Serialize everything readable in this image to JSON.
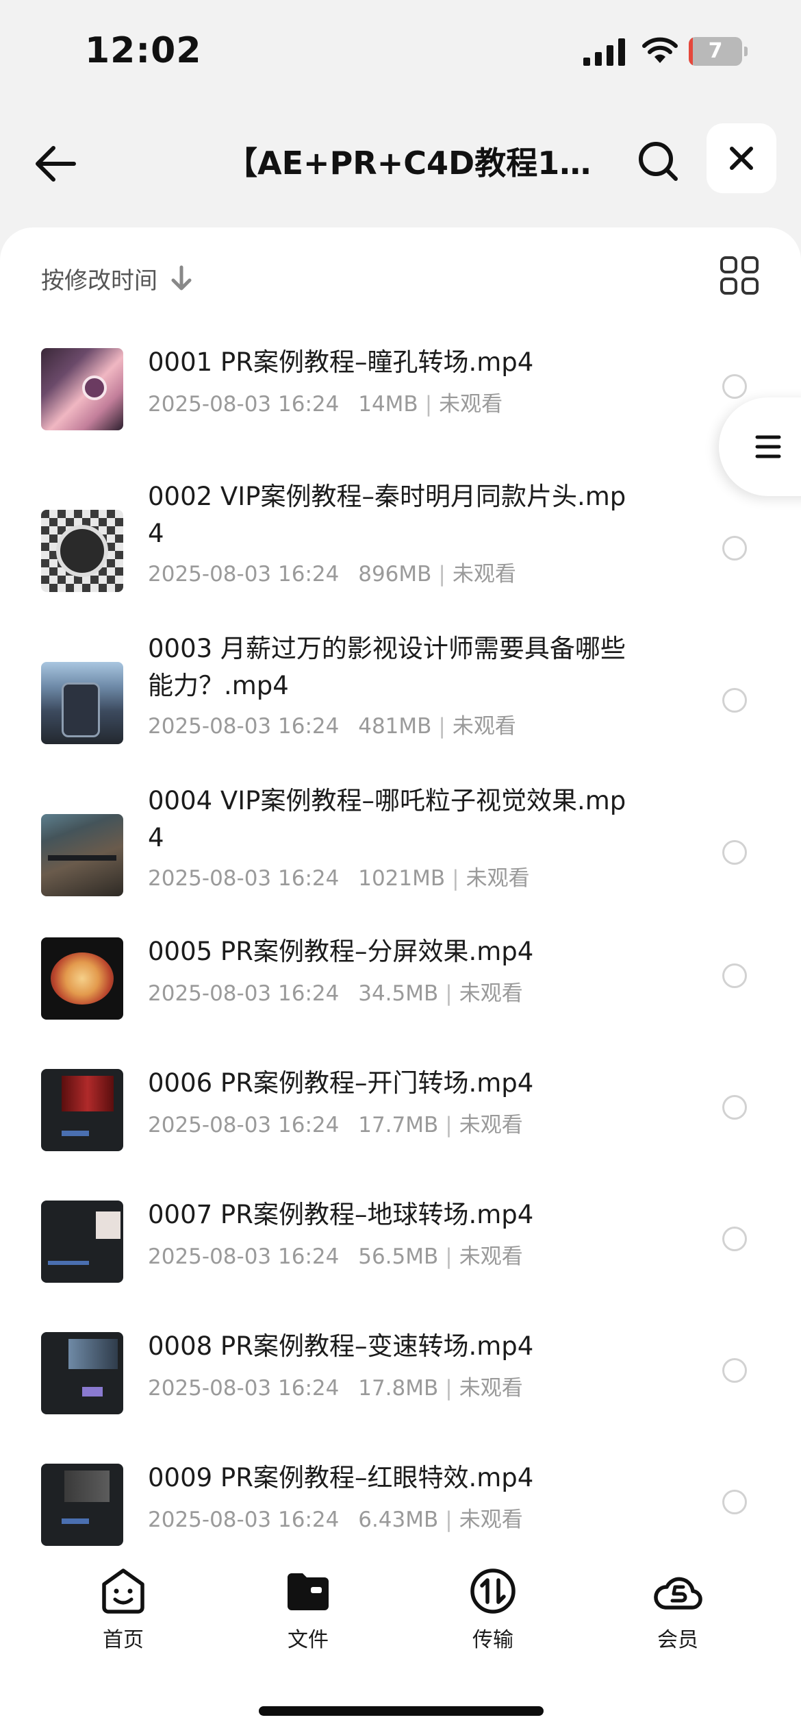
{
  "status": {
    "time": "12:02",
    "battery": "7",
    "battery_fraction": 0.07
  },
  "header": {
    "title": "【AE+PR+C4D教程10..."
  },
  "toolbar": {
    "sort_label": "按修改时间"
  },
  "files": [
    {
      "name": "0001 PR案例教程–瞳孔转场.mp4",
      "date": "2025-08-03 16:24",
      "size": "14MB",
      "status": "未观看"
    },
    {
      "name": "0002 VIP案例教程–秦时明月同款片头.mp4",
      "date": "2025-08-03 16:24",
      "size": "896MB",
      "status": "未观看"
    },
    {
      "name": "0003 月薪过万的影视设计师需要具备哪些能力？.mp4",
      "date": "2025-08-03 16:24",
      "size": "481MB",
      "status": "未观看"
    },
    {
      "name": "0004 VIP案例教程–哪吒粒子视觉效果.mp4",
      "date": "2025-08-03 16:24",
      "size": "1021MB",
      "status": "未观看"
    },
    {
      "name": "0005 PR案例教程–分屏效果.mp4",
      "date": "2025-08-03 16:24",
      "size": "34.5MB",
      "status": "未观看"
    },
    {
      "name": "0006 PR案例教程–开门转场.mp4",
      "date": "2025-08-03 16:24",
      "size": "17.7MB",
      "status": "未观看"
    },
    {
      "name": "0007 PR案例教程–地球转场.mp4",
      "date": "2025-08-03 16:24",
      "size": "56.5MB",
      "status": "未观看"
    },
    {
      "name": "0008 PR案例教程–变速转场.mp4",
      "date": "2025-08-03 16:24",
      "size": "17.8MB",
      "status": "未观看"
    },
    {
      "name": "0009 PR案例教程–红眼特效.mp4",
      "date": "2025-08-03 16:24",
      "size": "6.43MB",
      "status": "未观看"
    }
  ],
  "tabs": [
    {
      "label": "首页",
      "icon": "smiley-icon"
    },
    {
      "label": "文件",
      "icon": "folder-icon"
    },
    {
      "label": "传输",
      "icon": "transfer-icon"
    },
    {
      "label": "会员",
      "icon": "cloud-member-icon"
    }
  ]
}
